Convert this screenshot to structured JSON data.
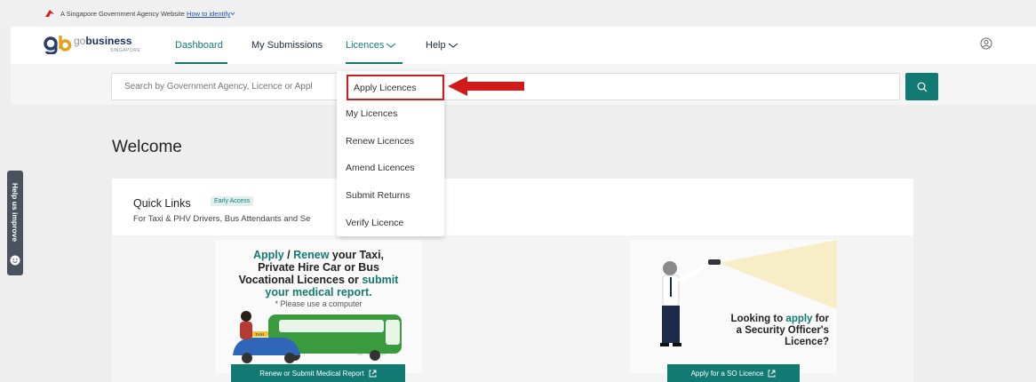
{
  "gov_bar": {
    "text": "A Singapore Government Agency Website",
    "link": "How to identify"
  },
  "logo": {
    "go": "go",
    "business": "business",
    "sub": "SINGAPORE"
  },
  "nav": {
    "dashboard": "Dashboard",
    "submissions": "My Submissions",
    "licences": "Licences",
    "help": "Help"
  },
  "search": {
    "placeholder": "Search by Government Agency, Licence or Appl"
  },
  "welcome": "Welcome",
  "quick_links": {
    "title": "Quick Links",
    "badge": "Early Access",
    "subtitle": "For Taxi & PHV Drivers, Bus Attendants and Se"
  },
  "dropdown": {
    "items": [
      "Apply Licences",
      "My Licences",
      "Renew Licences",
      "Amend Licences",
      "Submit Returns",
      "Verify Licence"
    ]
  },
  "promo1": {
    "line1a": "Apply",
    "line1b": " / ",
    "line1c": "Renew",
    "line1d": " your Taxi,",
    "line2": "Private Hire Car or Bus",
    "line3a": "Vocational Licences or ",
    "line3b": "submit",
    "line4": "your medical report.",
    "note": "* Please use a computer",
    "taxi_sign": "TAXI",
    "button": "Renew or Submit Medical Report"
  },
  "promo2": {
    "line1a": "Looking to ",
    "line1b": "apply",
    "line1c": " for",
    "line2": "a Security Officer's",
    "line3": "Licence?",
    "button": "Apply for a SO Licence"
  },
  "help_tab": "Help us improve",
  "colors": {
    "accent": "#127a72",
    "highlight": "#d11a1a"
  }
}
